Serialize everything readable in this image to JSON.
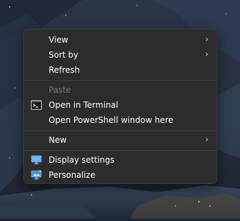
{
  "context_menu": {
    "items": [
      {
        "label": "View",
        "icon": "",
        "submenu": true,
        "disabled": false
      },
      {
        "label": "Sort by",
        "icon": "",
        "submenu": true,
        "disabled": false
      },
      {
        "label": "Refresh",
        "icon": "",
        "submenu": false,
        "disabled": false
      },
      {
        "label": "Paste",
        "icon": "",
        "submenu": false,
        "disabled": true
      },
      {
        "label": "Open in Terminal",
        "icon": "terminal-icon",
        "submenu": false,
        "disabled": false
      },
      {
        "label": "Open PowerShell window here",
        "icon": "",
        "submenu": false,
        "disabled": false
      },
      {
        "label": "New",
        "icon": "",
        "submenu": true,
        "disabled": false
      },
      {
        "label": "Display settings",
        "icon": "display-icon",
        "submenu": false,
        "disabled": false
      },
      {
        "label": "Personalize",
        "icon": "personalize-icon",
        "submenu": false,
        "disabled": false
      }
    ],
    "submenu_glyph": "›"
  },
  "colors": {
    "menu_bg": "#2c2c2c",
    "text": "#ffffff",
    "disabled_text": "#7a7a7a",
    "separator": "#3f3f3f",
    "icon_blue": "#4aa3f0"
  }
}
